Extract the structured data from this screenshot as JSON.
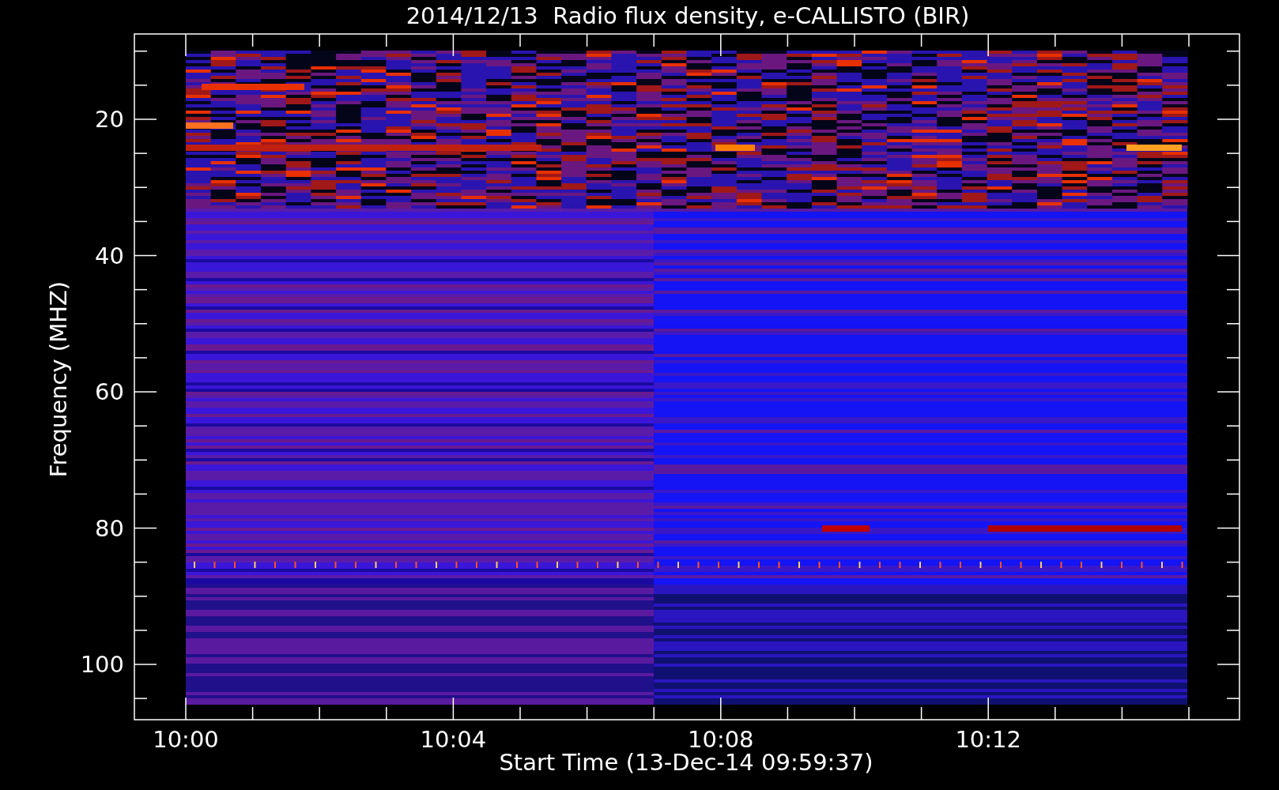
{
  "title": "2014/12/13  Radio flux density, e-CALLISTO (BIR)",
  "chart": {
    "ylabel": "Frequency (MHZ)",
    "xlabel": "Start Time (13-Dec-14 09:59:37)",
    "yticks": [
      "20",
      "40",
      "60",
      "80",
      "100"
    ],
    "xticks": [
      "10:00",
      "10:04",
      "10:08",
      "10:12"
    ]
  }
}
